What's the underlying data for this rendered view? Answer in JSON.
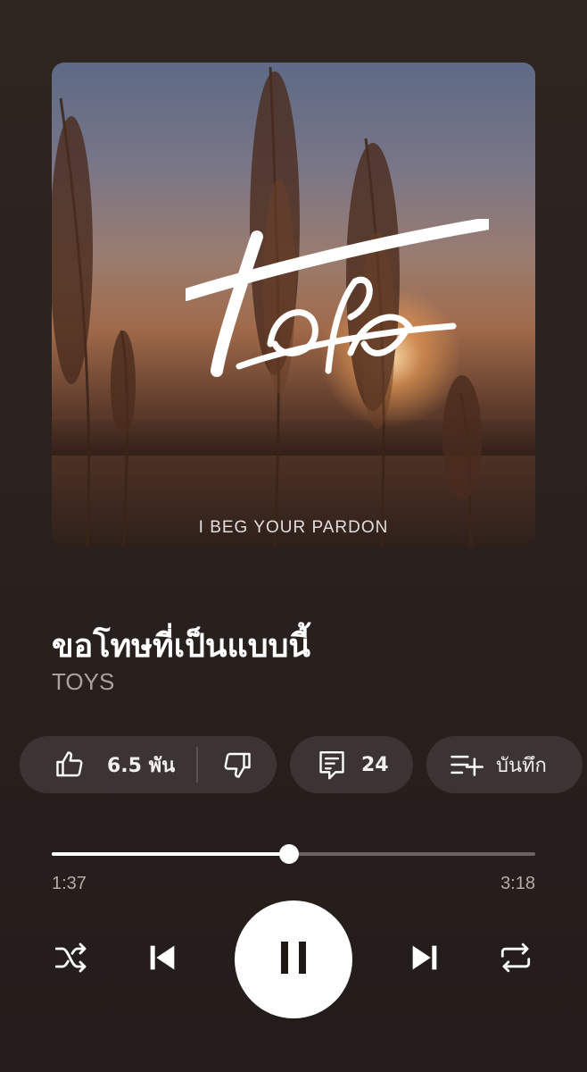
{
  "album_art": {
    "logo_text": "TOYS",
    "caption": "I BEG YOUR PARDON"
  },
  "song": {
    "title": "ขอโทษที่เป็นแบบนี้",
    "artist": "TOYS"
  },
  "actions": {
    "like_count": "6.5 พัน",
    "comment_count": "24",
    "save_label": "บันทึก"
  },
  "playback": {
    "elapsed": "1:37",
    "total": "3:18",
    "progress_fraction": 0.49
  },
  "colors": {
    "background": "#2b221f",
    "pill": "#3b3432",
    "accent": "#ffffff"
  },
  "icons": {
    "like": "thumbs-up-icon",
    "dislike": "thumbs-down-icon",
    "comment": "comment-icon",
    "save": "playlist-add-icon",
    "shuffle": "shuffle-icon",
    "previous": "skip-previous-icon",
    "pause": "pause-icon",
    "next": "skip-next-icon",
    "repeat": "repeat-icon"
  }
}
